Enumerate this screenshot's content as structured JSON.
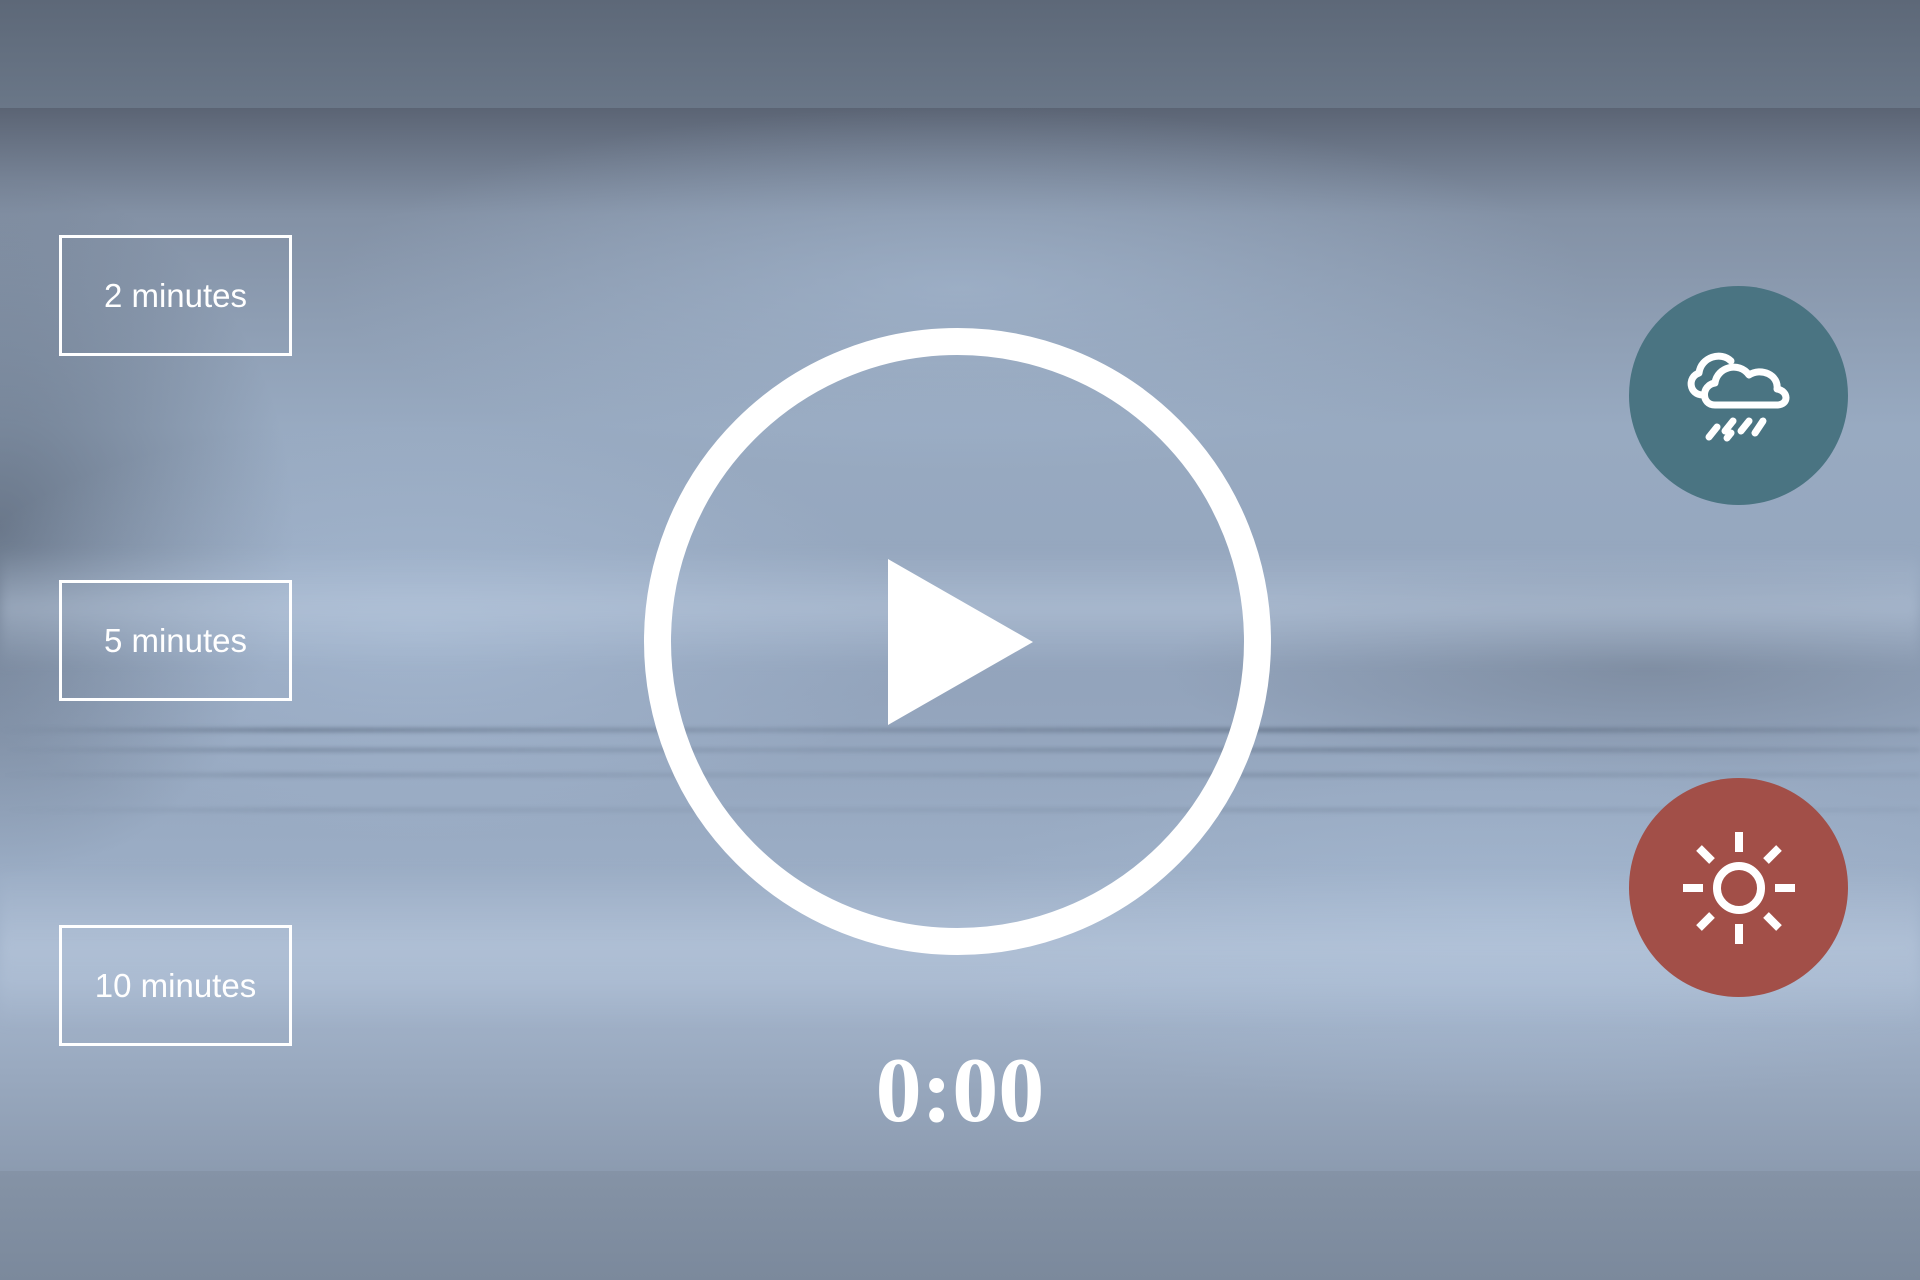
{
  "durations": [
    {
      "label": "2 minutes"
    },
    {
      "label": "5 minutes"
    },
    {
      "label": "10 minutes"
    }
  ],
  "player": {
    "icon": "play-icon",
    "timer": "0:00"
  },
  "modes": {
    "rain": {
      "icon": "cloud-rain-icon",
      "color": "#4a7482"
    },
    "sun": {
      "icon": "sun-icon",
      "color": "#a24f48"
    }
  }
}
